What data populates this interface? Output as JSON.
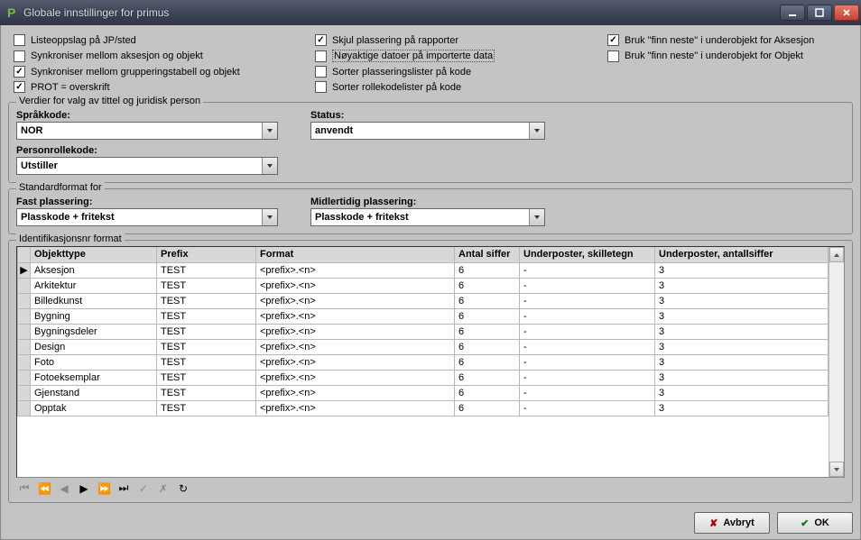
{
  "window": {
    "title": "Globale innstillinger for primus"
  },
  "checkboxes": {
    "col1": [
      {
        "label": "Listeoppslag på JP/sted",
        "checked": false
      },
      {
        "label": "Synkroniser mellom aksesjon og objekt",
        "checked": false
      },
      {
        "label": "Synkroniser mellom grupperingstabell  og objekt",
        "checked": true
      },
      {
        "label": "PROT = overskrift",
        "checked": true
      }
    ],
    "col2": [
      {
        "label": "Skjul plassering på rapporter",
        "checked": true
      },
      {
        "label": "Nøyaktige datoer på importerte data",
        "checked": false,
        "dashed": true
      },
      {
        "label": "Sorter plasseringslister på kode",
        "checked": false
      },
      {
        "label": "Sorter rollekodelister på kode",
        "checked": false
      }
    ],
    "col3": [
      {
        "label": "Bruk \"finn neste\"  i underobjekt for Aksesjon",
        "checked": true
      },
      {
        "label": "Bruk \"finn neste\"  i underobjekt for Objekt",
        "checked": false
      }
    ]
  },
  "group1": {
    "legend": "Verdier for valg av tittel og juridisk person",
    "sprakkode_label": "Språkkode:",
    "sprakkode_value": "NOR",
    "status_label": "Status:",
    "status_value": "anvendt",
    "personrollekode_label": "Personrollekode:",
    "personrollekode_value": "Utstiller"
  },
  "group2": {
    "legend": "Standardformat for",
    "fast_label": "Fast plassering:",
    "fast_value": "Plasskode + fritekst",
    "midl_label": "Midlertidig plassering:",
    "midl_value": "Plasskode + fritekst"
  },
  "grid": {
    "legend": "Identifikasjonsnr format",
    "headers": {
      "objekttype": "Objekttype",
      "prefix": "Prefix",
      "format": "Format",
      "antall_siffer": "Antal siffer",
      "underposter_skilletegn": "Underposter, skilletegn",
      "underposter_antallsiffer": "Underposter, antallsiffer"
    },
    "rows": [
      {
        "objekttype": "Aksesjon",
        "prefix": "TEST",
        "format": "<prefix>.<n>",
        "antall_siffer": "6",
        "skilletegn": "-",
        "antallsiffer": "3",
        "current": true
      },
      {
        "objekttype": "Arkitektur",
        "prefix": "TEST",
        "format": "<prefix>.<n>",
        "antall_siffer": "6",
        "skilletegn": "-",
        "antallsiffer": "3"
      },
      {
        "objekttype": "Billedkunst",
        "prefix": "TEST",
        "format": "<prefix>.<n>",
        "antall_siffer": "6",
        "skilletegn": "-",
        "antallsiffer": "3"
      },
      {
        "objekttype": "Bygning",
        "prefix": "TEST",
        "format": "<prefix>.<n>",
        "antall_siffer": "6",
        "skilletegn": "-",
        "antallsiffer": "3"
      },
      {
        "objekttype": "Bygningsdeler",
        "prefix": "TEST",
        "format": "<prefix>.<n>",
        "antall_siffer": "6",
        "skilletegn": "-",
        "antallsiffer": "3"
      },
      {
        "objekttype": "Design",
        "prefix": "TEST",
        "format": "<prefix>.<n>",
        "antall_siffer": "6",
        "skilletegn": "-",
        "antallsiffer": "3"
      },
      {
        "objekttype": "Foto",
        "prefix": "TEST",
        "format": "<prefix>.<n>",
        "antall_siffer": "6",
        "skilletegn": "-",
        "antallsiffer": "3"
      },
      {
        "objekttype": "Fotoeksemplar",
        "prefix": "TEST",
        "format": "<prefix>.<n>",
        "antall_siffer": "6",
        "skilletegn": "-",
        "antallsiffer": "3"
      },
      {
        "objekttype": "Gjenstand",
        "prefix": "TEST",
        "format": "<prefix>.<n>",
        "antall_siffer": "6",
        "skilletegn": "-",
        "antallsiffer": "3"
      },
      {
        "objekttype": "Opptak",
        "prefix": "TEST",
        "format": "<prefix>.<n>",
        "antall_siffer": "6",
        "skilletegn": "-",
        "antallsiffer": "3"
      }
    ]
  },
  "buttons": {
    "avbryt": "Avbryt",
    "ok": "OK"
  }
}
